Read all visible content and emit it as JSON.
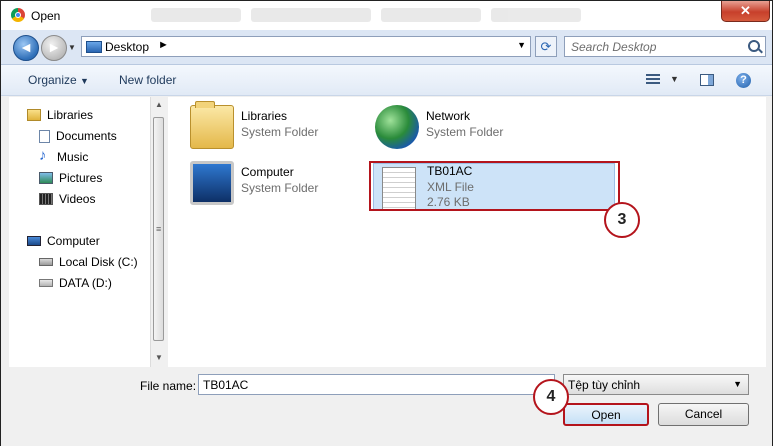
{
  "window": {
    "title": "Open",
    "close_label": "✕"
  },
  "nav": {
    "back_glyph": "◄",
    "forward_glyph": "►",
    "address_location": "Desktop",
    "address_separator": "►",
    "search_placeholder": "Search Desktop"
  },
  "toolbar": {
    "organize": "Organize",
    "organize_arrow": "▼",
    "new_folder": "New folder",
    "help": "?"
  },
  "sidebar": {
    "items": [
      {
        "label": "Libraries",
        "icon": "libraries-icon"
      },
      {
        "label": "Documents",
        "icon": "documents-icon"
      },
      {
        "label": "Music",
        "icon": "music-icon"
      },
      {
        "label": "Pictures",
        "icon": "pictures-icon"
      },
      {
        "label": "Videos",
        "icon": "videos-icon"
      },
      {
        "label": "Computer",
        "icon": "computer-icon"
      },
      {
        "label": "Local Disk (C:)",
        "icon": "local-disk-icon"
      },
      {
        "label": "DATA (D:)",
        "icon": "data-drive-icon"
      }
    ]
  },
  "files": [
    {
      "name": "Libraries",
      "type": "System Folder",
      "icon": "libraries-folder-icon"
    },
    {
      "name": "Network",
      "type": "System Folder",
      "icon": "network-icon"
    },
    {
      "name": "Computer",
      "type": "System Folder",
      "icon": "computer-icon"
    },
    {
      "name": "TB01AC",
      "type": "XML File",
      "size": "2.76 KB",
      "icon": "xml-file-icon",
      "selected": true
    }
  ],
  "annotations": {
    "step_file": "3",
    "step_open": "4",
    "highlight_color": "#b4141c"
  },
  "footer": {
    "file_name_label": "File name:",
    "file_name_value": "TB01AC",
    "file_type_value": "Tệp tùy chỉnh",
    "open_label": "Open",
    "cancel_label": "Cancel"
  }
}
